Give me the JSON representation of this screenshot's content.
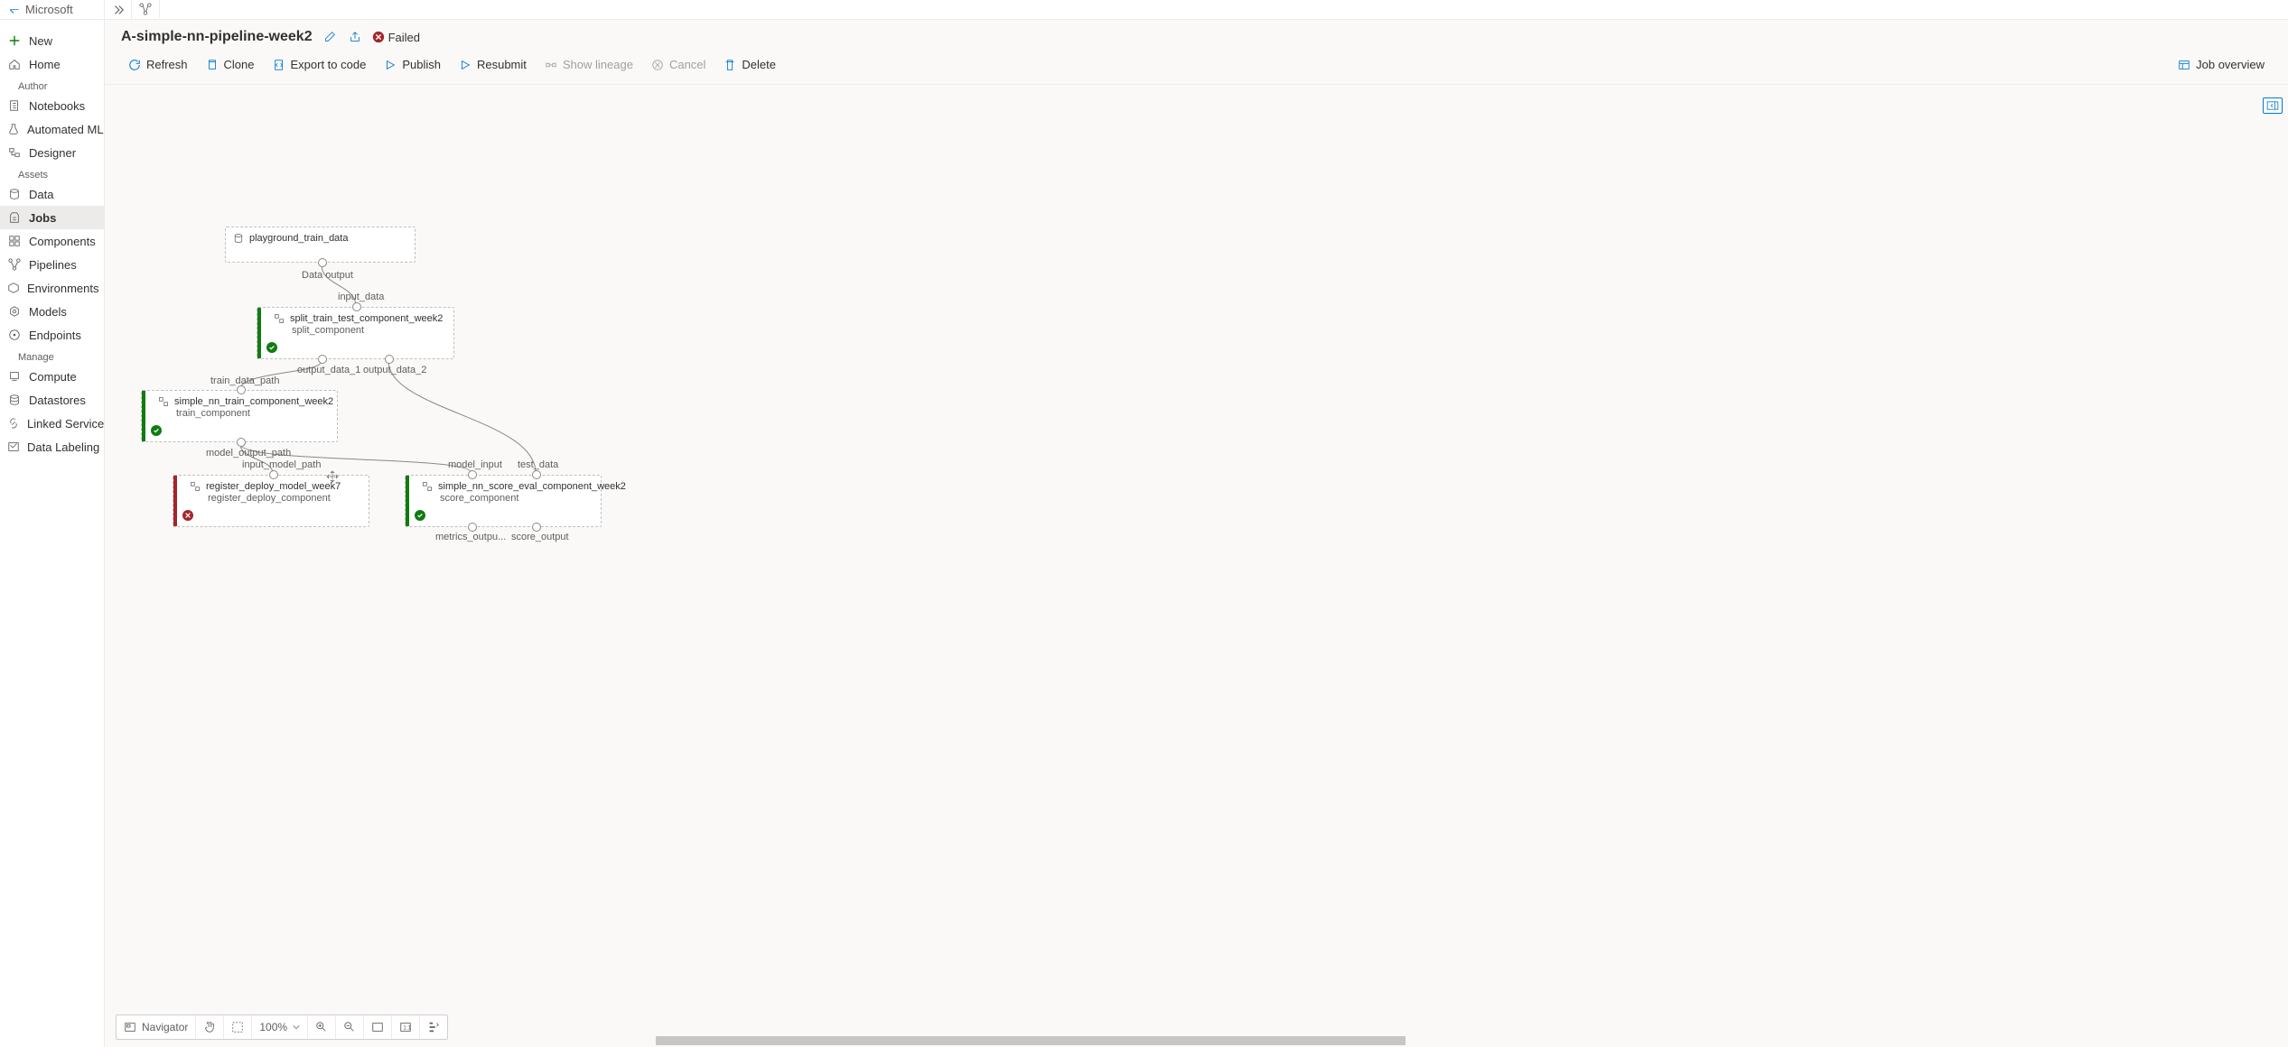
{
  "brand": "Microsoft",
  "sidebar": {
    "new": "New",
    "home": "Home",
    "sections": {
      "author": "Author",
      "assets": "Assets",
      "manage": "Manage"
    },
    "author_items": [
      {
        "label": "Notebooks"
      },
      {
        "label": "Automated ML"
      },
      {
        "label": "Designer"
      }
    ],
    "asset_items": [
      {
        "label": "Data"
      },
      {
        "label": "Jobs",
        "active": true
      },
      {
        "label": "Components"
      },
      {
        "label": "Pipelines"
      },
      {
        "label": "Environments"
      },
      {
        "label": "Models"
      },
      {
        "label": "Endpoints"
      }
    ],
    "manage_items": [
      {
        "label": "Compute"
      },
      {
        "label": "Datastores"
      },
      {
        "label": "Linked Services"
      },
      {
        "label": "Data Labeling"
      }
    ]
  },
  "header": {
    "title": "A-simple-nn-pipeline-week2",
    "status_label": "Failed"
  },
  "toolbar": {
    "refresh": "Refresh",
    "clone": "Clone",
    "export": "Export to code",
    "publish": "Publish",
    "resubmit": "Resubmit",
    "lineage": "Show lineage",
    "cancel": "Cancel",
    "delete": "Delete",
    "overview": "Job overview"
  },
  "graph": {
    "nodes": {
      "data": {
        "title": "playground_train_data",
        "out": "Data output"
      },
      "split": {
        "title": "split_train_test_component_week2",
        "subtitle": "split_component",
        "in": "input_data",
        "out1": "output_data_1",
        "out2": "output_data_2"
      },
      "train": {
        "title": "simple_nn_train_component_week2",
        "subtitle": "train_component",
        "in": "train_data_path",
        "out": "model_output_path"
      },
      "register": {
        "title": "register_deploy_model_week7",
        "subtitle": "register_deploy_component",
        "in": "input_model_path"
      },
      "score": {
        "title": "simple_nn_score_eval_component_week2",
        "subtitle": "score_component",
        "in1": "model_input",
        "in2": "test_data",
        "out1": "metrics_outpu...",
        "out2": "score_output"
      }
    }
  },
  "bottombar": {
    "navigator": "Navigator",
    "zoom": "100%"
  }
}
